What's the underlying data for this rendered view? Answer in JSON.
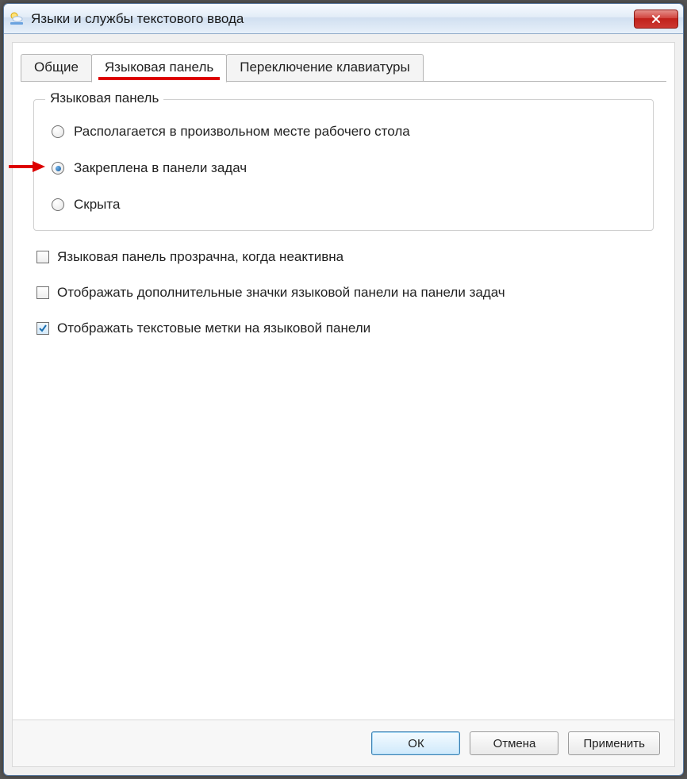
{
  "window": {
    "title": "Языки и службы текстового ввода"
  },
  "tabs": {
    "general": "Общие",
    "language_bar": "Языковая панель",
    "keyboard_switch": "Переключение клавиатуры",
    "active": "language_bar"
  },
  "group": {
    "legend": "Языковая панель",
    "radios": {
      "floating": {
        "label": "Располагается в произвольном месте рабочего стола",
        "checked": false
      },
      "docked": {
        "label": "Закреплена в панели задач",
        "checked": true
      },
      "hidden": {
        "label": "Скрыта",
        "checked": false
      }
    }
  },
  "checks": {
    "transparent": {
      "label": "Языковая панель прозрачна, когда неактивна",
      "checked": false
    },
    "extra_icons": {
      "label": "Отображать дополнительные значки языковой панели на панели задач",
      "checked": false
    },
    "text_labels": {
      "label": "Отображать текстовые метки на языковой панели",
      "checked": true
    }
  },
  "buttons": {
    "ok": "ОК",
    "cancel": "Отмена",
    "apply": "Применить"
  }
}
